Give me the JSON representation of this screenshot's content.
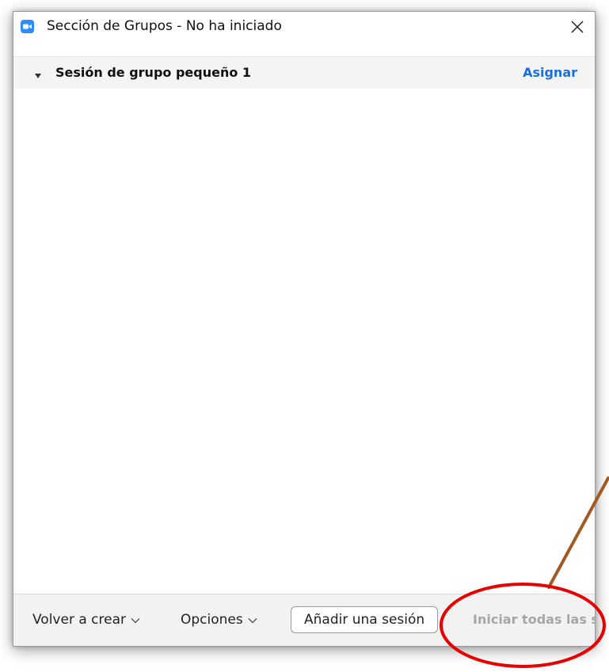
{
  "window": {
    "title": "Sección de Grupos - No ha iniciado",
    "app_icon": "zoom-camera-icon",
    "close_icon": "close-icon",
    "accent_color": "#2d8cff"
  },
  "group": {
    "name": "Sesión de grupo pequeño 1",
    "expand_icon": "caret-down-icon",
    "assign_label": "Asignar",
    "assign_color": "#1a6fe0"
  },
  "footer": {
    "recreate_label": "Volver a crear",
    "options_label": "Opciones",
    "add_session_label": "Añadir una sesión",
    "start_all_label": "Iniciar todas las sesiones",
    "start_all_color": "#a6a6a6"
  },
  "annotation": {
    "type": "red-circle-highlight",
    "circle_color": "#e60000",
    "arrow_color": "#a35a22"
  }
}
